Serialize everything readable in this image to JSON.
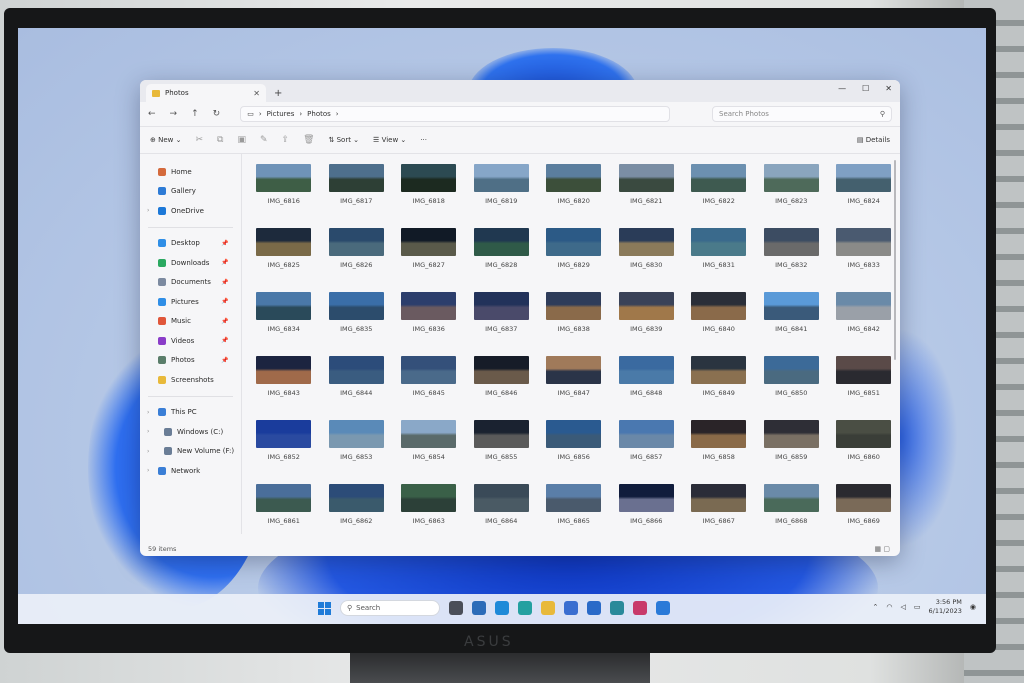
{
  "window": {
    "tab_title": "Photos",
    "tab_close": "✕",
    "new_tab": "+",
    "controls": {
      "minimize": "—",
      "maximize": "☐",
      "close": "✕"
    }
  },
  "address": {
    "back": "←",
    "forward": "→",
    "up": "↑",
    "refresh": "↻",
    "breadcrumb": [
      "Pictures",
      "Photos"
    ],
    "search_placeholder": "Search Photos"
  },
  "toolbar": {
    "new_label": "New",
    "sort_label": "Sort",
    "view_label": "View",
    "more_label": "···",
    "details_label": "Details"
  },
  "sidebar": {
    "top": [
      {
        "label": "Home",
        "color": "#d46a3c"
      },
      {
        "label": "Gallery",
        "color": "#2d7bd6"
      },
      {
        "label": "OneDrive",
        "color": "#1c78d8"
      }
    ],
    "pinned": [
      {
        "label": "Desktop",
        "color": "#2f8ee6"
      },
      {
        "label": "Downloads",
        "color": "#2aa860"
      },
      {
        "label": "Documents",
        "color": "#7c8aa0"
      },
      {
        "label": "Pictures",
        "color": "#2f8ee6"
      },
      {
        "label": "Music",
        "color": "#e0563a"
      },
      {
        "label": "Videos",
        "color": "#8a3cc8"
      },
      {
        "label": "Photos",
        "color": "#5a7d6a"
      },
      {
        "label": "Screenshots",
        "color": "#e8b93a"
      }
    ],
    "drives": [
      {
        "label": "This PC",
        "color": "#3a7ed6"
      },
      {
        "label": "Windows (C:)",
        "color": "#6a7d96"
      },
      {
        "label": "New Volume (F:)",
        "color": "#6a7d96"
      },
      {
        "label": "Network",
        "color": "#3a7ed6"
      }
    ]
  },
  "files": [
    "IMG_6816",
    "IMG_6817",
    "IMG_6818",
    "IMG_6819",
    "IMG_6820",
    "IMG_6821",
    "IMG_6822",
    "IMG_6823",
    "IMG_6824",
    "IMG_6825",
    "IMG_6826",
    "IMG_6827",
    "IMG_6828",
    "IMG_6829",
    "IMG_6830",
    "IMG_6831",
    "IMG_6832",
    "IMG_6833",
    "IMG_6834",
    "IMG_6835",
    "IMG_6836",
    "IMG_6837",
    "IMG_6838",
    "IMG_6839",
    "IMG_6840",
    "IMG_6841",
    "IMG_6842",
    "IMG_6843",
    "IMG_6844",
    "IMG_6845",
    "IMG_6846",
    "IMG_6847",
    "IMG_6848",
    "IMG_6849",
    "IMG_6850",
    "IMG_6851",
    "IMG_6852",
    "IMG_6853",
    "IMG_6854",
    "IMG_6855",
    "IMG_6856",
    "IMG_6857",
    "IMG_6858",
    "IMG_6859",
    "IMG_6860",
    "IMG_6861",
    "IMG_6862",
    "IMG_6863",
    "IMG_6864",
    "IMG_6865",
    "IMG_6866",
    "IMG_6867",
    "IMG_6868",
    "IMG_6869"
  ],
  "thumb_palette": [
    [
      "#6f93b8",
      "#3e5e46"
    ],
    [
      "#4e6f8c",
      "#2d3f35"
    ],
    [
      "#2c4a52",
      "#1c2a20"
    ],
    [
      "#86a6c8",
      "#4f6f86"
    ],
    [
      "#5b7e9e",
      "#3c4f3a"
    ],
    [
      "#7b8ea4",
      "#3a4a40"
    ],
    [
      "#6c90b0",
      "#3e5a50"
    ],
    [
      "#8aa5be",
      "#4e6a5a"
    ],
    [
      "#7fa0c4",
      "#44606e"
    ],
    [
      "#1d2a3c",
      "#7a6a48"
    ],
    [
      "#2a4a6c",
      "#4a6a7c"
    ],
    [
      "#111a26",
      "#5a5a4a"
    ],
    [
      "#203850",
      "#2f5a48"
    ],
    [
      "#2c5a86",
      "#3e6a8a"
    ],
    [
      "#2a3c58",
      "#8a7a5a"
    ],
    [
      "#3a6a8c",
      "#4a7a8a"
    ],
    [
      "#3c4c62",
      "#6a6a6a"
    ],
    [
      "#4a5a70",
      "#8a8a88"
    ],
    [
      "#4a78a8",
      "#2a4a5a"
    ],
    [
      "#3a6ea8",
      "#2c4c6c"
    ],
    [
      "#2c3e6c",
      "#6a5a60"
    ],
    [
      "#22325a",
      "#4a4a6a"
    ],
    [
      "#2e3c5a",
      "#8a6a4a"
    ],
    [
      "#3a4258",
      "#a0784a"
    ],
    [
      "#2a2e38",
      "#8a6a4a"
    ],
    [
      "#5a9ad8",
      "#3a5a7a"
    ],
    [
      "#6a8aa8",
      "#9aa0a8"
    ],
    [
      "#1c2440",
      "#a06a4a"
    ],
    [
      "#2c4c7a",
      "#3a5c80"
    ],
    [
      "#34507a",
      "#4a6a8a"
    ],
    [
      "#161c28",
      "#6a5a4a"
    ],
    [
      "#a07a5a",
      "#2a3448"
    ],
    [
      "#3a6aa0",
      "#4a7aa8"
    ],
    [
      "#2a3440",
      "#8a7050"
    ],
    [
      "#3c6a98",
      "#4a6a80"
    ],
    [
      "#5a4a48",
      "#2a2a30"
    ],
    [
      "#1a3c9c",
      "#2a4aa0"
    ],
    [
      "#5a8ab8",
      "#7a98b0"
    ],
    [
      "#8aa8c8",
      "#5a6a6a"
    ],
    [
      "#1a2230",
      "#5a5a5a"
    ],
    [
      "#2a5a90",
      "#3a5a78"
    ],
    [
      "#4a78b0",
      "#6a88a8"
    ],
    [
      "#2a2428",
      "#8a6a48"
    ],
    [
      "#2e2e36",
      "#7a7064"
    ],
    [
      "#4a4e44",
      "#3a3e38"
    ],
    [
      "#4a6e9a",
      "#3c5a50"
    ],
    [
      "#2c4c78",
      "#3a5a6c"
    ],
    [
      "#3a6048",
      "#2c4038"
    ],
    [
      "#3a4a58",
      "#4a5a64"
    ],
    [
      "#5a7ea8",
      "#4a5a6c"
    ],
    [
      "#101c3c",
      "#6a7090"
    ],
    [
      "#2a2c38",
      "#7a6a52"
    ],
    [
      "#6a8aa8",
      "#4a6a5a"
    ],
    [
      "#2a2a30",
      "#7a6a58"
    ]
  ],
  "status": {
    "item_count": "59 items"
  },
  "taskbar": {
    "search_label": "Search",
    "time": "3:56 PM",
    "date": "6/11/2023",
    "apps": [
      "#4a4e58",
      "#2c6cb8",
      "#1f8ad8",
      "#24a0a0",
      "#e8b93a",
      "#3a6ed0",
      "#2a6ac8",
      "#2a8a9a",
      "#c83a6a",
      "#2a7ad8"
    ]
  },
  "monitor": {
    "brand": "ASUS"
  }
}
